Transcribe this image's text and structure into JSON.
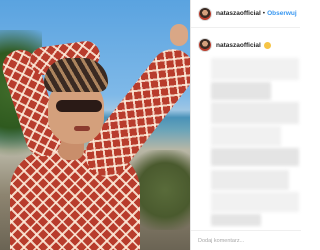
{
  "post": {
    "author": {
      "username": "nataszaofficial",
      "follow_label": "Obserwuj",
      "separator": "•"
    },
    "caption": {
      "username": "nataszaofficial",
      "emoji": "smiley-face-emoji"
    },
    "comment_box": {
      "placeholder": "Dodaj komentarz..."
    }
  },
  "colors": {
    "follow_blue": "#3897f0",
    "username_text": "#262626",
    "placeholder_text": "#a8a8a8",
    "dress_red": "#b83c2c"
  }
}
